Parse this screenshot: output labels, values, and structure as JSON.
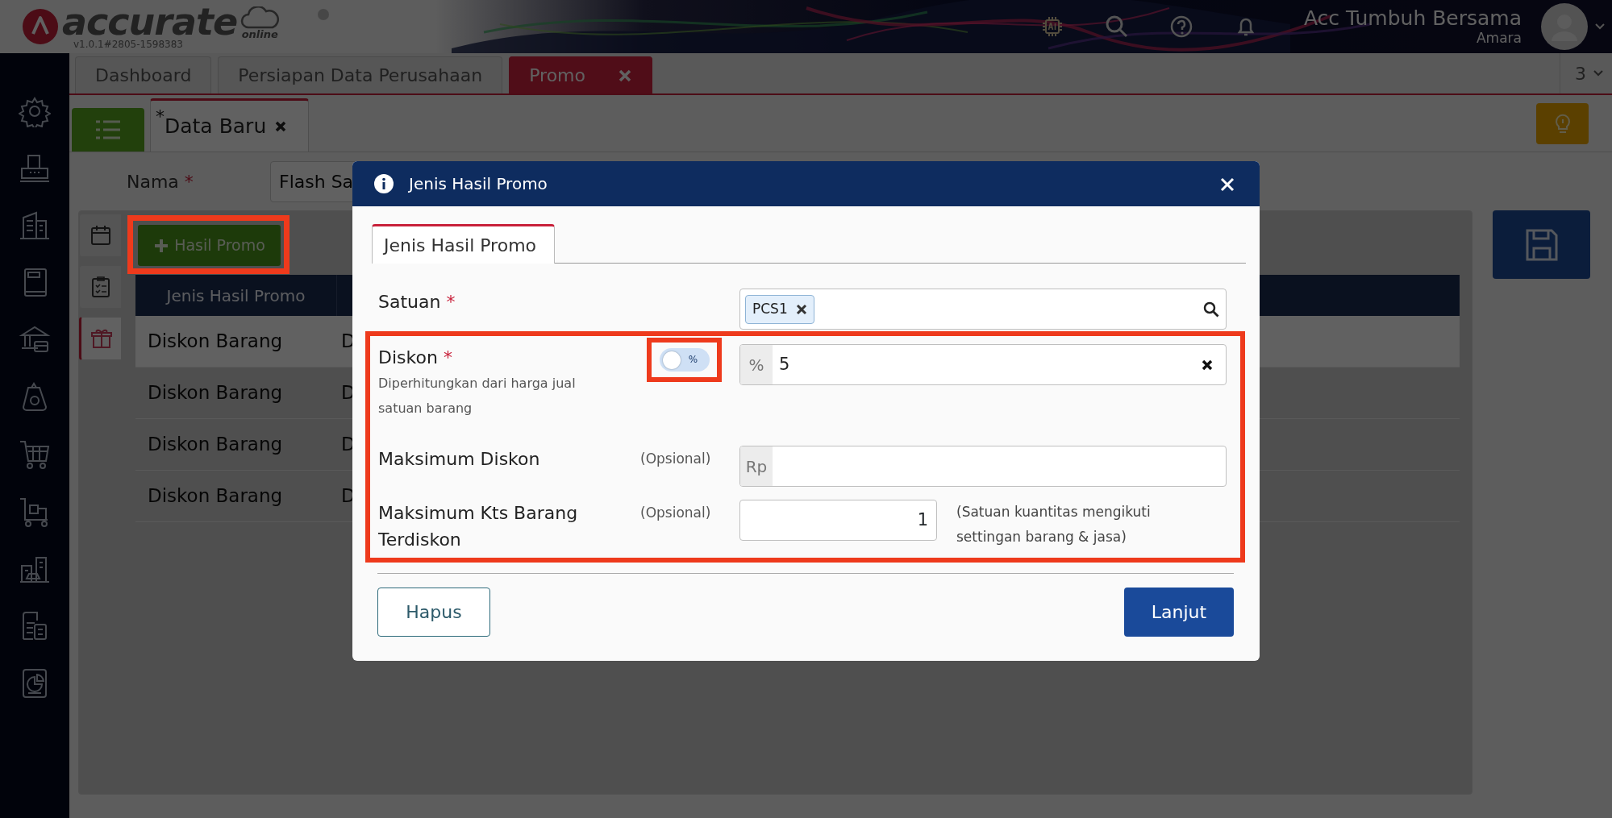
{
  "header": {
    "logo_text": "accurate",
    "logo_subtext": "online",
    "version": "v1.0.1#2805-1598383",
    "company": "Acc Tumbuh Bersama",
    "user": "Amara"
  },
  "tabs": [
    {
      "label": "Dashboard",
      "selected": false,
      "closable": false
    },
    {
      "label": "Persiapan Data Perusahaan",
      "selected": false,
      "closable": false
    },
    {
      "label": "Promo",
      "selected": true,
      "closable": true
    }
  ],
  "tab_count": "3",
  "doc_tabs": [
    {
      "marker": "*",
      "label": "Data Baru",
      "selected": true
    }
  ],
  "form": {
    "label": "Nama",
    "required_mark": "*",
    "value": "Flash Sa"
  },
  "side_tabs": [
    {
      "selected": false
    },
    {
      "selected": false
    },
    {
      "selected": true
    }
  ],
  "add_button": {
    "label": "Hasil Promo",
    "highlighted": true
  },
  "table": {
    "columns": [
      "Jenis Hasil Promo"
    ],
    "rows": [
      {
        "column_1": "Diskon Barang",
        "column_2": "D",
        "selected": true
      },
      {
        "column_1": "Diskon Barang",
        "column_2": "D",
        "selected": false
      },
      {
        "column_1": "Diskon Barang",
        "column_2": "D",
        "selected": false
      },
      {
        "column_1": "Diskon Barang",
        "column_2": "D",
        "selected": false
      }
    ]
  },
  "dialog": {
    "title": "Jenis Hasil Promo",
    "tabs": [
      {
        "label": "Jenis Hasil Promo",
        "selected": true
      }
    ],
    "fields": [
      {
        "kind": "tags",
        "label": "Satuan",
        "required_mark": "*",
        "tags": [
          "PCS1"
        ],
        "highlighted": false
      },
      {
        "kind": "discount",
        "label": "Diskon",
        "required_mark": "*",
        "hint": "Diperhitungkan dari harga jual satuan barang",
        "toggle": {
          "label": "%",
          "on": false,
          "highlighted": true
        },
        "prefix": "%",
        "value": "5",
        "highlighted": true
      },
      {
        "kind": "prefixed",
        "label": "Maksimum Diskon",
        "optional": "(Opsional)",
        "prefix": "Rp",
        "highlighted": true
      },
      {
        "kind": "quantity",
        "label": "Maksimum Kts Barang Terdiskon",
        "optional": "(Opsional)",
        "value": "1",
        "note": "(Satuan kuantitas mengikuti settingan barang & jasa)",
        "highlighted": true
      }
    ],
    "buttons": [
      {
        "label": "Hapus",
        "kind": "outline"
      },
      {
        "label": "Lanjut",
        "kind": "primary"
      }
    ]
  }
}
